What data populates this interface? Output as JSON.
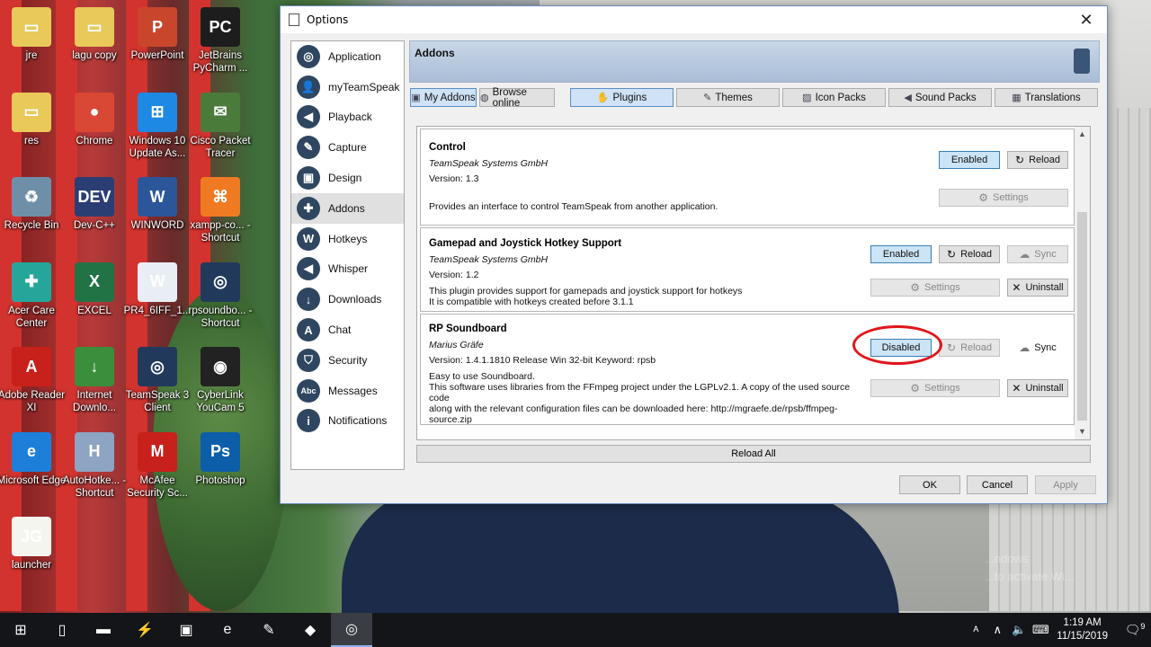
{
  "desktop": {
    "icons": [
      {
        "label": "jre",
        "glyph": "▭",
        "color": "#e8c95a"
      },
      {
        "label": "lagu copy",
        "glyph": "▭",
        "color": "#e8c95a"
      },
      {
        "label": "PowerPoint",
        "glyph": "P",
        "color": "#c9462c"
      },
      {
        "label": "JetBrains PyCharm ...",
        "glyph": "PC",
        "color": "#1d1d1d"
      },
      {
        "label": "res",
        "glyph": "▭",
        "color": "#e8c95a"
      },
      {
        "label": "Chrome",
        "glyph": "●",
        "color": "#d94735"
      },
      {
        "label": "Windows 10 Update As...",
        "glyph": "⊞",
        "color": "#1e88e5"
      },
      {
        "label": "Cisco Packet Tracer",
        "glyph": "✉",
        "color": "#4b7b3a"
      },
      {
        "label": "Recycle Bin",
        "glyph": "♻",
        "color": "#6f8fa8"
      },
      {
        "label": "Dev-C++",
        "glyph": "DEV",
        "color": "#2b3e73"
      },
      {
        "label": "WINWORD",
        "glyph": "W",
        "color": "#2b579a"
      },
      {
        "label": "xampp-co... - Shortcut",
        "glyph": "⌘",
        "color": "#f07a22"
      },
      {
        "label": "Acer Care Center",
        "glyph": "✚",
        "color": "#26a69a"
      },
      {
        "label": "EXCEL",
        "glyph": "X",
        "color": "#217346"
      },
      {
        "label": "PR4_6IFF_1...",
        "glyph": "W",
        "color": "#e9eef5"
      },
      {
        "label": "rpsoundbo... - Shortcut",
        "glyph": "◎",
        "color": "#213a5c"
      },
      {
        "label": "Adobe Reader XI",
        "glyph": "A",
        "color": "#c8201a"
      },
      {
        "label": "Internet Downlo...",
        "glyph": "↓",
        "color": "#3b8e3b"
      },
      {
        "label": "TeamSpeak 3 Client",
        "glyph": "◎",
        "color": "#213a5c"
      },
      {
        "label": "CyberLink YouCam 5",
        "glyph": "◉",
        "color": "#222"
      },
      {
        "label": "Microsoft Edge",
        "glyph": "e",
        "color": "#1e7fd8"
      },
      {
        "label": "AutoHotke... - Shortcut",
        "glyph": "H",
        "color": "#8da4c3"
      },
      {
        "label": "McAfee Security Sc...",
        "glyph": "M",
        "color": "#c8201a"
      },
      {
        "label": "Photoshop",
        "glyph": "Ps",
        "color": "#0c5ea8"
      },
      {
        "label": "launcher",
        "glyph": "JG",
        "color": "#f5f5f0"
      }
    ],
    "watermark_line1": "...ndows",
    "watermark_line2": "...to activate Wi..."
  },
  "window": {
    "title": "Options",
    "close_glyph": "✕",
    "sidebar": [
      {
        "label": "Application",
        "icon": "application-icon",
        "glyph": "◎",
        "color": "#2f4660"
      },
      {
        "label": "myTeamSpeak",
        "icon": "user-icon",
        "glyph": "👤",
        "color": "#2f4660"
      },
      {
        "label": "Playback",
        "icon": "speaker-icon",
        "glyph": "◀",
        "color": "#2f4660"
      },
      {
        "label": "Capture",
        "icon": "microphone-icon",
        "glyph": "✎",
        "color": "#2f4660"
      },
      {
        "label": "Design",
        "icon": "design-icon",
        "glyph": "▣",
        "color": "#2f4660"
      },
      {
        "label": "Addons",
        "icon": "puzzle-icon",
        "glyph": "✚",
        "color": "#2f4660"
      },
      {
        "label": "Hotkeys",
        "icon": "keyboard-icon",
        "glyph": "W",
        "color": "#2f4660"
      },
      {
        "label": "Whisper",
        "icon": "whisper-icon",
        "glyph": "◀",
        "color": "#2f4660"
      },
      {
        "label": "Downloads",
        "icon": "download-icon",
        "glyph": "↓",
        "color": "#2f4660"
      },
      {
        "label": "Chat",
        "icon": "chat-icon",
        "glyph": "A",
        "color": "#2f4660"
      },
      {
        "label": "Security",
        "icon": "shield-icon",
        "glyph": "⛉",
        "color": "#2f4660"
      },
      {
        "label": "Messages",
        "icon": "messages-icon",
        "glyph": "Abc",
        "color": "#2f4660"
      },
      {
        "label": "Notifications",
        "icon": "info-icon",
        "glyph": "i",
        "color": "#2f4660"
      }
    ],
    "active_section": "Addons",
    "panel_title": "Addons",
    "tabs": {
      "my_addons": "My Addons",
      "browse_online": "Browse online",
      "plugins": "Plugins",
      "themes": "Themes",
      "icon_packs": "Icon Packs",
      "sound_packs": "Sound Packs",
      "translations": "Translations"
    },
    "addons": [
      {
        "name": "Control",
        "author": "TeamSpeak Systems GmbH",
        "version": "Version: 1.3",
        "description": [
          "Provides an interface to control TeamSpeak from another application."
        ],
        "state_label": "Enabled",
        "reload_label": "Reload",
        "settings_label": "Settings"
      },
      {
        "name": "Gamepad and Joystick Hotkey Support",
        "author": "TeamSpeak Systems GmbH",
        "version": "Version: 1.2",
        "description": [
          "This plugin provides support for gamepads and joystick support for hotkeys",
          "It is compatible with hotkeys created before 3.1.1"
        ],
        "state_label": "Enabled",
        "reload_label": "Reload",
        "sync_label": "Sync",
        "settings_label": "Settings",
        "uninstall_label": "Uninstall"
      },
      {
        "name": "RP Soundboard",
        "author": "Marius Gräfe",
        "version": "Version: 1.4.1.1810 Release Win 32-bit    Keyword: rpsb",
        "description": [
          "Easy to use Soundboard.",
          "This software uses libraries from the FFmpeg project under the LGPLv2.1. A copy of the used source code",
          "along with the relevant configuration files can be downloaded here: http://mgraefe.de/rpsb/ffmpeg-",
          "source.zip"
        ],
        "state_label": "Disabled",
        "reload_label": "Reload",
        "sync_label": "Sync",
        "settings_label": "Settings",
        "uninstall_label": "Uninstall"
      }
    ],
    "reload_all": "Reload All",
    "ok": "OK",
    "cancel": "Cancel",
    "apply": "Apply"
  },
  "taskbar": {
    "items": [
      {
        "name": "start-button",
        "glyph": "⊞"
      },
      {
        "name": "task-view-button",
        "glyph": "▯"
      },
      {
        "name": "file-explorer-button",
        "glyph": "▬"
      },
      {
        "name": "app-lightning-button",
        "glyph": "⚡"
      },
      {
        "name": "app-game-button",
        "glyph": "▣"
      },
      {
        "name": "edge-button",
        "glyph": "e"
      },
      {
        "name": "app-paint-button",
        "glyph": "✎"
      },
      {
        "name": "app-notes-button",
        "glyph": "◆"
      },
      {
        "name": "teamspeak-button",
        "glyph": "◎"
      }
    ],
    "tray": {
      "people": "ᴬ",
      "chevron": "∧",
      "volume": "🔈",
      "keyboard": "⌨",
      "time": "1:19 AM",
      "date": "11/15/2019",
      "notifications": "9"
    }
  }
}
